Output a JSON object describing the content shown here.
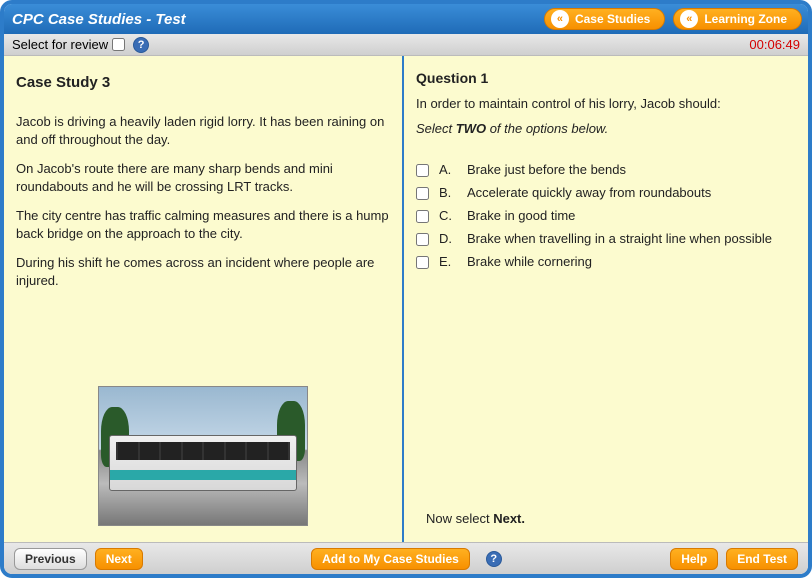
{
  "header": {
    "title": "CPC Case Studies - Test",
    "nav": [
      {
        "label": "Case Studies"
      },
      {
        "label": "Learning Zone"
      }
    ]
  },
  "subbar": {
    "review_label": "Select for review",
    "timer": "00:06:49"
  },
  "case": {
    "heading": "Case Study 3",
    "paragraphs": [
      "Jacob is driving a heavily laden rigid lorry. It has been raining on and off throughout the day.",
      "On Jacob's route there are many sharp bends and mini roundabouts and he will be crossing LRT tracks.",
      "The city centre has traffic calming measures and there is a hump back bridge on the approach to the city.",
      "During his shift he comes across an incident where people are injured."
    ]
  },
  "question": {
    "heading": "Question 1",
    "prompt": "In order to maintain control of his lorry, Jacob should:",
    "instruction_prefix": "Select ",
    "instruction_bold": "TWO",
    "instruction_suffix": " of the options below.",
    "options": [
      {
        "letter": "A.",
        "text": "Brake just before the bends"
      },
      {
        "letter": "B.",
        "text": "Accelerate quickly away from roundabouts"
      },
      {
        "letter": "C.",
        "text": "Brake in good time"
      },
      {
        "letter": "D.",
        "text": "Brake when travelling in a straight line when possible"
      },
      {
        "letter": "E.",
        "text": "Brake while cornering"
      }
    ],
    "now_select_prefix": "Now select ",
    "now_select_bold": "Next."
  },
  "footer": {
    "previous": "Previous",
    "next": "Next",
    "add": "Add to My Case Studies",
    "help": "Help",
    "end": "End Test"
  }
}
